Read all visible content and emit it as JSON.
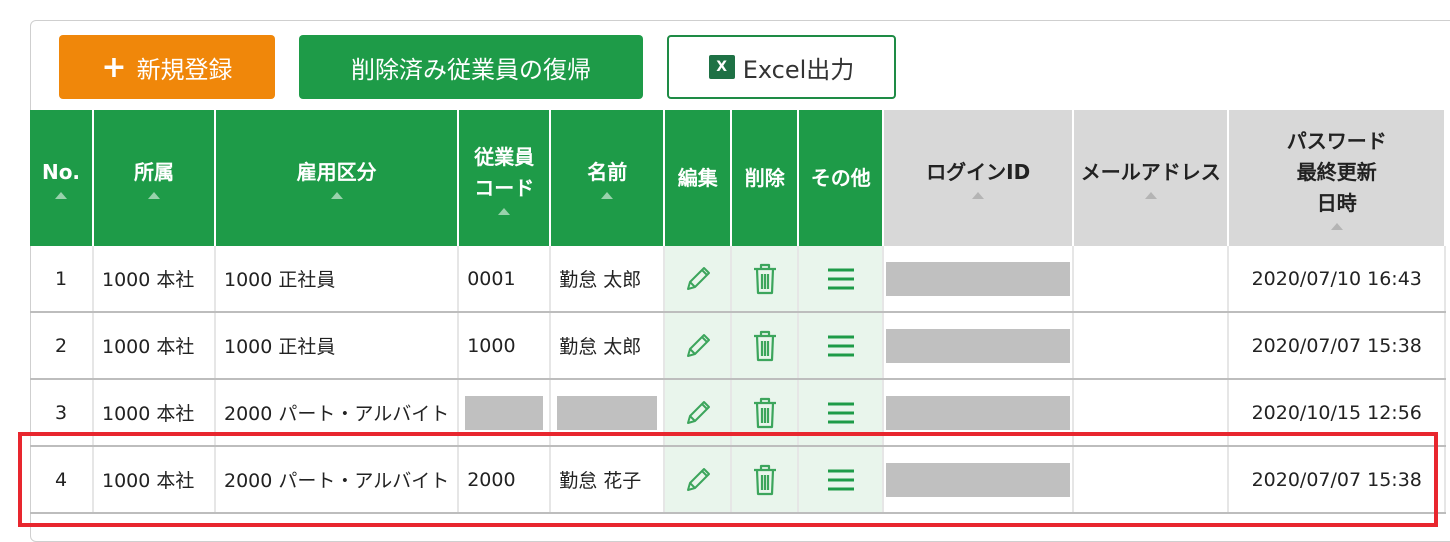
{
  "toolbar": {
    "new_label": "新規登録",
    "restore_label": "削除済み従業員の復帰",
    "excel_label": "Excel出力",
    "excel_badge": "X"
  },
  "table": {
    "headers": {
      "no": "No.",
      "dept": "所属",
      "employment": "雇用区分",
      "code_line1": "従業員",
      "code_line2": "コード",
      "name": "名前",
      "edit": "編集",
      "delete": "削除",
      "other": "その他",
      "login": "ログインID",
      "email": "メールアドレス",
      "pw_line1": "パスワード",
      "pw_line2": "最終更新",
      "pw_line3": "日時"
    },
    "rows": [
      {
        "no": "1",
        "dept": "1000 本社",
        "employment": "1000 正社員",
        "code": "0001",
        "name": "勤怠 太郎",
        "email": "",
        "pw_updated": "2020/07/10 16:43"
      },
      {
        "no": "2",
        "dept": "1000 本社",
        "employment": "1000 正社員",
        "code": "1000",
        "name": "勤怠 太郎",
        "email": "",
        "pw_updated": "2020/07/07 15:38"
      },
      {
        "no": "3",
        "dept": "1000 本社",
        "employment": "2000 パート・アルバイト",
        "code": "",
        "name": "",
        "email": "",
        "pw_updated": "2020/10/15 12:56"
      },
      {
        "no": "4",
        "dept": "1000 本社",
        "employment": "2000 パート・アルバイト",
        "code": "2000",
        "name": "勤怠 花子",
        "email": "",
        "pw_updated": "2020/07/07 15:38"
      }
    ]
  },
  "colors": {
    "green_header": "#1E9B48",
    "orange_button": "#F0870A",
    "highlight": "#E8262E"
  },
  "icons": [
    "plus-icon",
    "excel-icon",
    "pencil-icon",
    "trash-icon",
    "menu-icon",
    "sort-icon"
  ]
}
